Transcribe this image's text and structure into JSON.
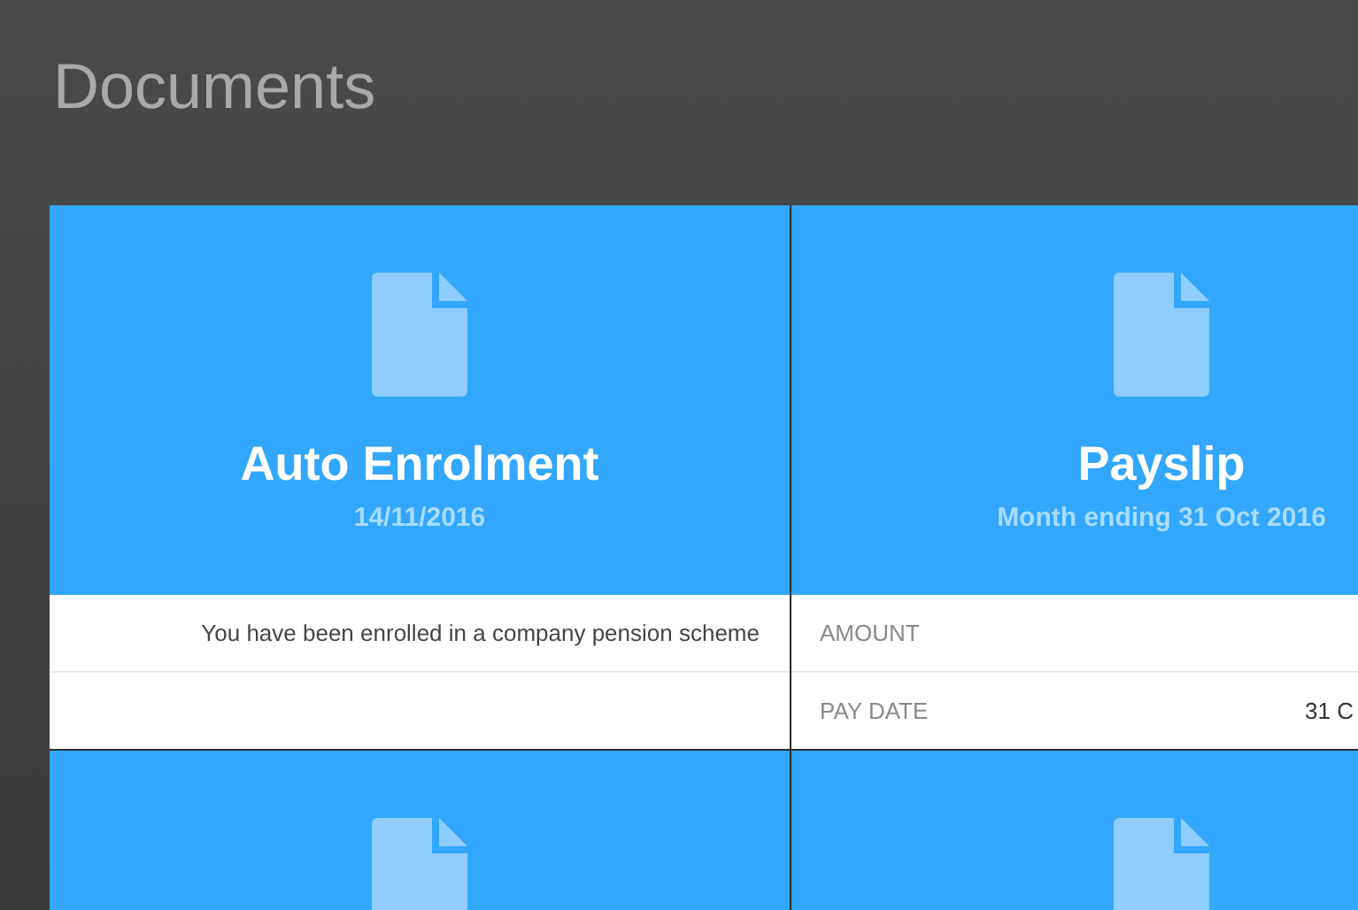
{
  "page_title": "Documents",
  "documents": [
    {
      "title": "Auto Enrolment",
      "subtitle": "14/11/2016",
      "kind": "note",
      "rows": [
        {
          "text": "You have been enrolled in a company pension scheme"
        },
        {
          "text": ""
        }
      ]
    },
    {
      "title": "Payslip",
      "subtitle": "Month ending 31 Oct 2016",
      "kind": "fields",
      "rows": [
        {
          "label": "AMOUNT"
        },
        {
          "label": "PAY DATE",
          "value": "31 C"
        }
      ]
    },
    {
      "kind": "cut"
    },
    {
      "kind": "cut"
    }
  ]
}
